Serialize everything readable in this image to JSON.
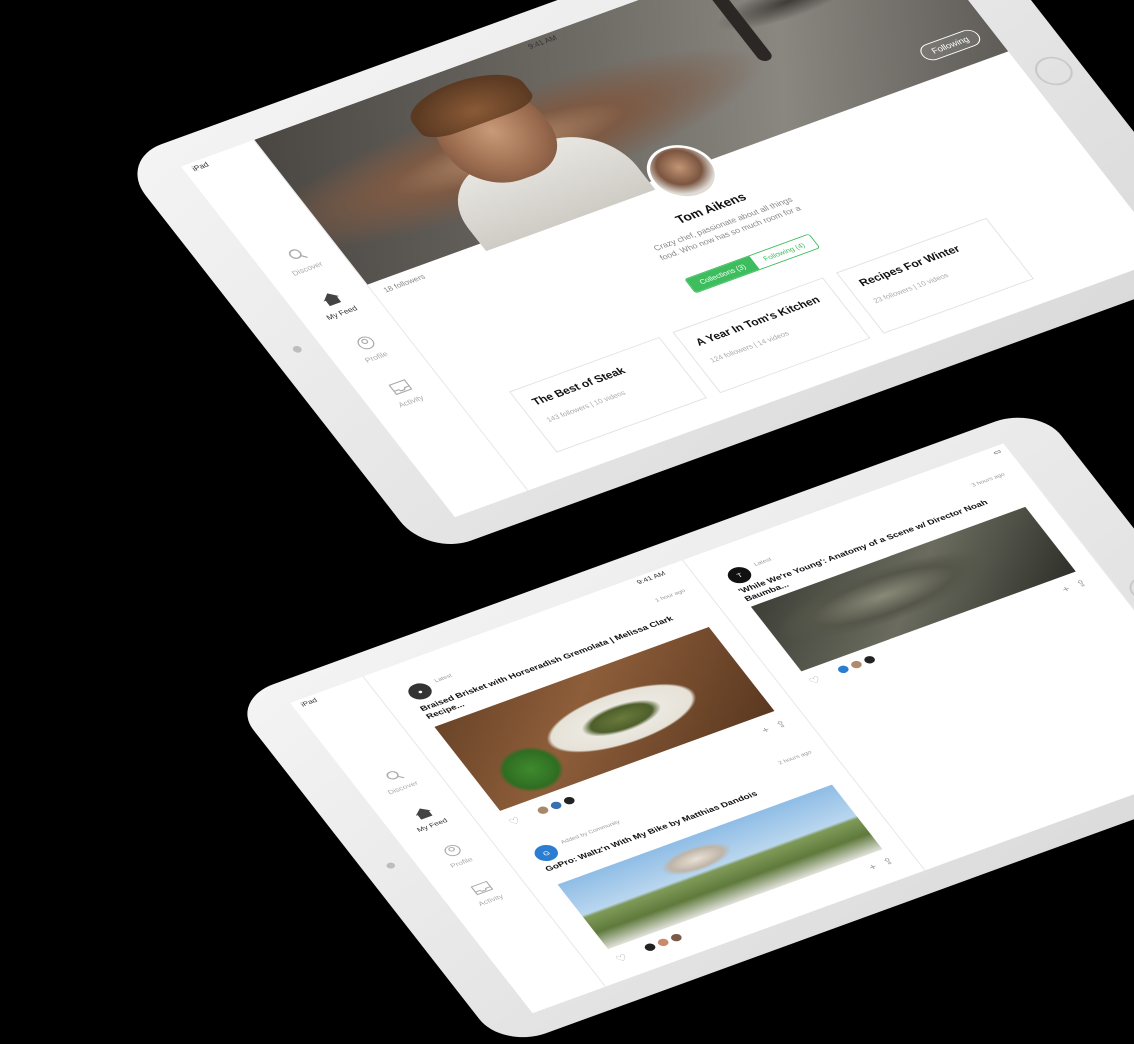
{
  "profile_screen": {
    "status": {
      "carrier": "iPad",
      "time": "9:41 AM"
    },
    "nav": [
      {
        "label": "Discover",
        "icon": "search-icon"
      },
      {
        "label": "My Feed",
        "icon": "home-icon"
      },
      {
        "label": "Profile",
        "icon": "user-icon"
      },
      {
        "label": "Activity",
        "icon": "inbox-icon"
      }
    ],
    "following_button": "Following",
    "name": "Tom Aikens",
    "bio": "Crazy chef, passionate about all things food. Who now has so much room for a",
    "followers": "18 followers",
    "tabs": {
      "collections": "Collections (3)",
      "following": "Following (4)"
    },
    "collections": [
      {
        "title": "The Best of Steak",
        "followers": "143 followers",
        "videos": "10 videos"
      },
      {
        "title": "A Year In Tom's Kitchen",
        "followers": "124 followers",
        "videos": "14 videos"
      },
      {
        "title": "Recipes For Winter",
        "followers": "23 followers",
        "videos": "10 videos"
      }
    ],
    "colors": {
      "accent": "#3dbd5d"
    }
  },
  "feed_screen": {
    "status": {
      "carrier": "iPad",
      "time": "9:41 AM"
    },
    "nav": [
      {
        "label": "Discover",
        "icon": "search-icon"
      },
      {
        "label": "My Feed",
        "icon": "home-icon"
      },
      {
        "label": "Profile",
        "icon": "user-icon"
      },
      {
        "label": "Activity",
        "icon": "inbox-icon"
      }
    ],
    "cards": [
      {
        "meta": "Latest",
        "title": "Braised Brisket with Horseradish Gremolata | Melissa Clark Recipe...",
        "time": "1 hour ago"
      },
      {
        "meta": "Added by Community",
        "title": "GoPro: Waltz'n With My Bike by Matthias Dandois",
        "time": "2 hours ago"
      },
      {
        "meta": "Latest",
        "title": "'While We're Young': Anatomy of a Scene w/ Director Noah Baumba...",
        "time": "3 hours ago"
      }
    ]
  }
}
